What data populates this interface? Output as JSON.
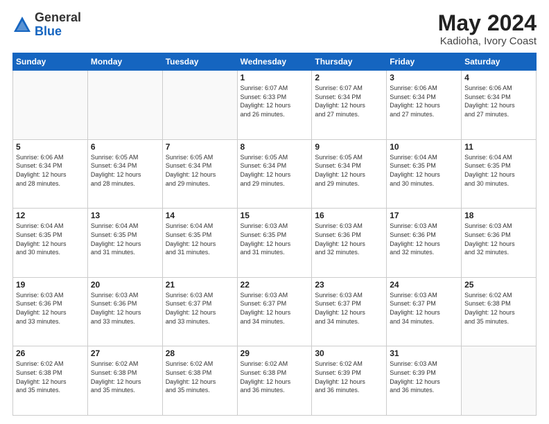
{
  "logo": {
    "general": "General",
    "blue": "Blue"
  },
  "header": {
    "month_year": "May 2024",
    "location": "Kadioha, Ivory Coast"
  },
  "weekdays": [
    "Sunday",
    "Monday",
    "Tuesday",
    "Wednesday",
    "Thursday",
    "Friday",
    "Saturday"
  ],
  "weeks": [
    [
      {
        "day": "",
        "info": ""
      },
      {
        "day": "",
        "info": ""
      },
      {
        "day": "",
        "info": ""
      },
      {
        "day": "1",
        "info": "Sunrise: 6:07 AM\nSunset: 6:33 PM\nDaylight: 12 hours\nand 26 minutes."
      },
      {
        "day": "2",
        "info": "Sunrise: 6:07 AM\nSunset: 6:34 PM\nDaylight: 12 hours\nand 27 minutes."
      },
      {
        "day": "3",
        "info": "Sunrise: 6:06 AM\nSunset: 6:34 PM\nDaylight: 12 hours\nand 27 minutes."
      },
      {
        "day": "4",
        "info": "Sunrise: 6:06 AM\nSunset: 6:34 PM\nDaylight: 12 hours\nand 27 minutes."
      }
    ],
    [
      {
        "day": "5",
        "info": "Sunrise: 6:06 AM\nSunset: 6:34 PM\nDaylight: 12 hours\nand 28 minutes."
      },
      {
        "day": "6",
        "info": "Sunrise: 6:05 AM\nSunset: 6:34 PM\nDaylight: 12 hours\nand 28 minutes."
      },
      {
        "day": "7",
        "info": "Sunrise: 6:05 AM\nSunset: 6:34 PM\nDaylight: 12 hours\nand 29 minutes."
      },
      {
        "day": "8",
        "info": "Sunrise: 6:05 AM\nSunset: 6:34 PM\nDaylight: 12 hours\nand 29 minutes."
      },
      {
        "day": "9",
        "info": "Sunrise: 6:05 AM\nSunset: 6:34 PM\nDaylight: 12 hours\nand 29 minutes."
      },
      {
        "day": "10",
        "info": "Sunrise: 6:04 AM\nSunset: 6:35 PM\nDaylight: 12 hours\nand 30 minutes."
      },
      {
        "day": "11",
        "info": "Sunrise: 6:04 AM\nSunset: 6:35 PM\nDaylight: 12 hours\nand 30 minutes."
      }
    ],
    [
      {
        "day": "12",
        "info": "Sunrise: 6:04 AM\nSunset: 6:35 PM\nDaylight: 12 hours\nand 30 minutes."
      },
      {
        "day": "13",
        "info": "Sunrise: 6:04 AM\nSunset: 6:35 PM\nDaylight: 12 hours\nand 31 minutes."
      },
      {
        "day": "14",
        "info": "Sunrise: 6:04 AM\nSunset: 6:35 PM\nDaylight: 12 hours\nand 31 minutes."
      },
      {
        "day": "15",
        "info": "Sunrise: 6:03 AM\nSunset: 6:35 PM\nDaylight: 12 hours\nand 31 minutes."
      },
      {
        "day": "16",
        "info": "Sunrise: 6:03 AM\nSunset: 6:36 PM\nDaylight: 12 hours\nand 32 minutes."
      },
      {
        "day": "17",
        "info": "Sunrise: 6:03 AM\nSunset: 6:36 PM\nDaylight: 12 hours\nand 32 minutes."
      },
      {
        "day": "18",
        "info": "Sunrise: 6:03 AM\nSunset: 6:36 PM\nDaylight: 12 hours\nand 32 minutes."
      }
    ],
    [
      {
        "day": "19",
        "info": "Sunrise: 6:03 AM\nSunset: 6:36 PM\nDaylight: 12 hours\nand 33 minutes."
      },
      {
        "day": "20",
        "info": "Sunrise: 6:03 AM\nSunset: 6:36 PM\nDaylight: 12 hours\nand 33 minutes."
      },
      {
        "day": "21",
        "info": "Sunrise: 6:03 AM\nSunset: 6:37 PM\nDaylight: 12 hours\nand 33 minutes."
      },
      {
        "day": "22",
        "info": "Sunrise: 6:03 AM\nSunset: 6:37 PM\nDaylight: 12 hours\nand 34 minutes."
      },
      {
        "day": "23",
        "info": "Sunrise: 6:03 AM\nSunset: 6:37 PM\nDaylight: 12 hours\nand 34 minutes."
      },
      {
        "day": "24",
        "info": "Sunrise: 6:03 AM\nSunset: 6:37 PM\nDaylight: 12 hours\nand 34 minutes."
      },
      {
        "day": "25",
        "info": "Sunrise: 6:02 AM\nSunset: 6:38 PM\nDaylight: 12 hours\nand 35 minutes."
      }
    ],
    [
      {
        "day": "26",
        "info": "Sunrise: 6:02 AM\nSunset: 6:38 PM\nDaylight: 12 hours\nand 35 minutes."
      },
      {
        "day": "27",
        "info": "Sunrise: 6:02 AM\nSunset: 6:38 PM\nDaylight: 12 hours\nand 35 minutes."
      },
      {
        "day": "28",
        "info": "Sunrise: 6:02 AM\nSunset: 6:38 PM\nDaylight: 12 hours\nand 35 minutes."
      },
      {
        "day": "29",
        "info": "Sunrise: 6:02 AM\nSunset: 6:38 PM\nDaylight: 12 hours\nand 36 minutes."
      },
      {
        "day": "30",
        "info": "Sunrise: 6:02 AM\nSunset: 6:39 PM\nDaylight: 12 hours\nand 36 minutes."
      },
      {
        "day": "31",
        "info": "Sunrise: 6:03 AM\nSunset: 6:39 PM\nDaylight: 12 hours\nand 36 minutes."
      },
      {
        "day": "",
        "info": ""
      }
    ]
  ]
}
